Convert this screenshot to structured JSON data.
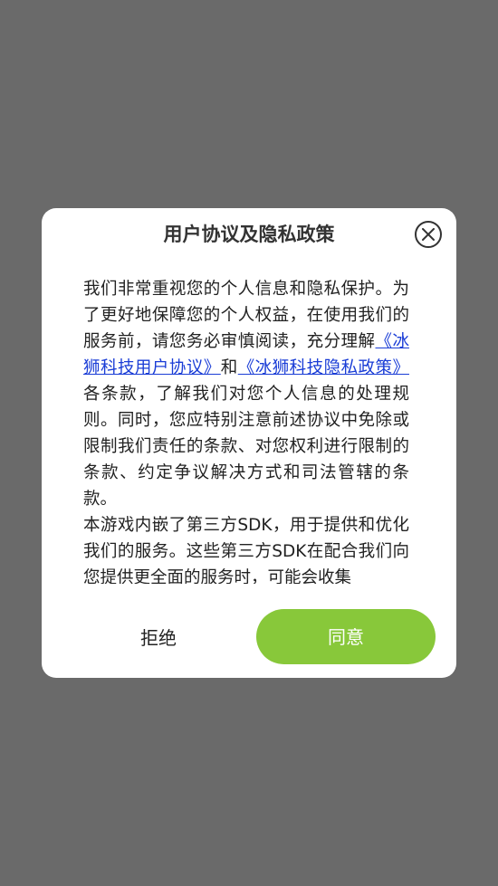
{
  "dialog": {
    "title": "用户协议及隐私政策",
    "close_icon": "close-icon",
    "paragraph1": {
      "text_before": "我们非常重视您的个人信息和隐私保护。为了更好地保障您的个人权益，在使用我们的服务前，请您务必审慎阅读，充分理解",
      "link_user_agreement": "《冰狮科技用户协议》",
      "text_and": "和",
      "link_privacy_policy": "《冰狮科技隐私政策》",
      "text_after": "各条款，了解我们对您个人信息的处理规则。同时，您应特别注意前述协议中免除或限制我们责任的条款、对您权利进行限制的条款、约定争议解决方式和司法管辖的条款。"
    },
    "paragraph2": "本游戏内嵌了第三方SDK，用于提供和优化我们的服务。这些第三方SDK在配合我们向您提供更全面的服务时，可能会收集",
    "reject_label": "拒绝",
    "agree_label": "同意",
    "colors": {
      "overlay": "#6a6a6a",
      "agree_button": "#88c83a",
      "link": "#1a3dd6"
    }
  }
}
